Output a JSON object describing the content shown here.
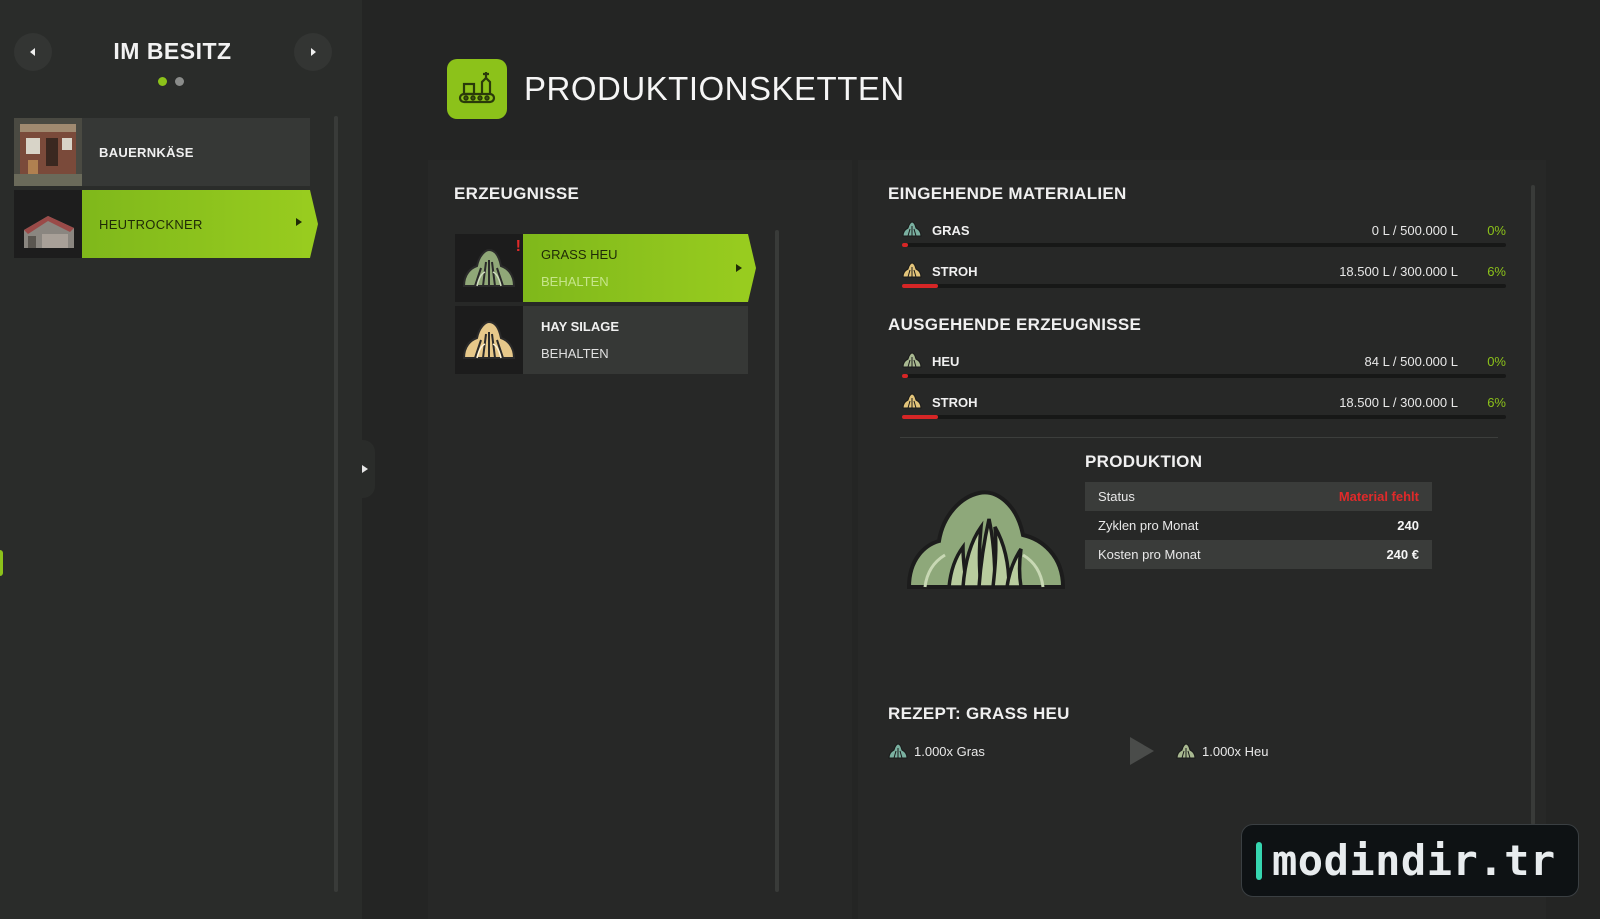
{
  "sidebar": {
    "title": "IM BESITZ",
    "pages": 2,
    "active_page": 1,
    "items": [
      {
        "label": "BAUERNKÄSE",
        "selected": false
      },
      {
        "label": "HEUTROCKNER",
        "selected": true
      }
    ]
  },
  "header": {
    "title": "PRODUKTIONSKETTEN",
    "icon": "production-chain-icon"
  },
  "products": {
    "title": "ERZEUGNISSE",
    "items": [
      {
        "name": "GRASS HEU",
        "mode": "BEHALTEN",
        "selected": true,
        "warning": "!"
      },
      {
        "name": "HAY SILAGE",
        "mode": "BEHALTEN",
        "selected": false
      }
    ]
  },
  "incoming": {
    "title": "EINGEHENDE MATERIALIEN",
    "items": [
      {
        "name": "GRAS",
        "amount": "0 L / 500.000 L",
        "percent": "0%",
        "fill": 0.01,
        "icon": "grass-pile-icon"
      },
      {
        "name": "STROH",
        "amount": "18.500 L / 300.000 L",
        "percent": "6%",
        "fill": 0.06,
        "icon": "straw-pile-icon"
      }
    ]
  },
  "outgoing": {
    "title": "AUSGEHENDE ERZEUGNISSE",
    "items": [
      {
        "name": "HEU",
        "amount": "84 L / 500.000 L",
        "percent": "0%",
        "fill": 0.01,
        "icon": "hay-pile-icon"
      },
      {
        "name": "STROH",
        "amount": "18.500 L / 300.000 L",
        "percent": "6%",
        "fill": 0.06,
        "icon": "straw-pile-icon"
      }
    ]
  },
  "production": {
    "title": "PRODUKTION",
    "rows": [
      {
        "key": "Status",
        "value": "Material fehlt",
        "error": true
      },
      {
        "key": "Zyklen pro Monat",
        "value": "240"
      },
      {
        "key": "Kosten pro Monat",
        "value": "240 €"
      }
    ]
  },
  "recipe": {
    "title": "REZEPT: GRASS HEU",
    "input": "1.000x Gras",
    "output": "1.000x Heu"
  },
  "watermark": {
    "text": "modindir.tr"
  },
  "colors": {
    "accent": "#8cc21a",
    "error": "#e02a2a",
    "background": "#242524"
  }
}
